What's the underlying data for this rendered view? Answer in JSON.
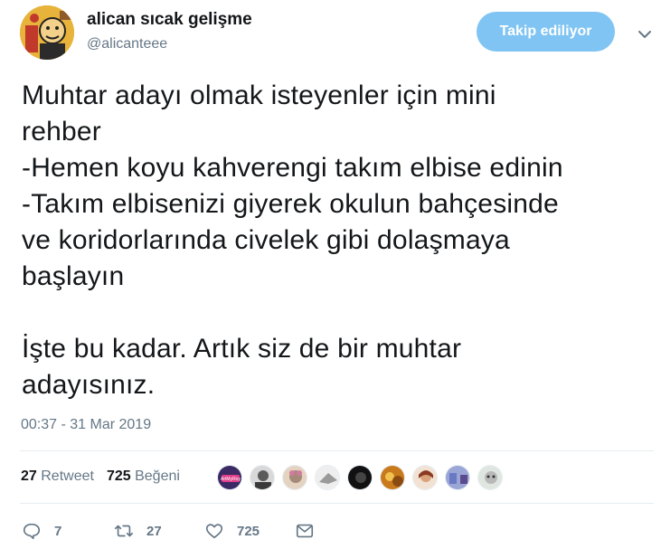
{
  "author": {
    "display_name": "alican sıcak gelişme",
    "handle": "@alicanteee",
    "follow_label": "Takip ediliyor"
  },
  "tweet": {
    "text": "Muhtar adayı olmak isteyenler için mini\nrehber\n-Hemen koyu kahverengi takım elbise edinin\n-Takım elbisenizi giyerek okulun bahçesinde\nve koridorlarında civelek gibi dolaşmaya\nbaşlayın\n\nİşte bu kadar. Artık siz de bir muhtar\nadayısınız.",
    "timestamp": "00:37 - 31 Mar 2019"
  },
  "stats": {
    "retweet_count": "27",
    "retweet_label": "Retweet",
    "like_count": "725",
    "like_label": "Beğeni"
  },
  "actions": {
    "reply_count": "7",
    "retweet_count": "27",
    "like_count": "725"
  },
  "likers_badge": "ArtMyRoy",
  "colors": {
    "accent": "#7fc4f3",
    "muted": "#657786",
    "text": "#14171a"
  },
  "icons": [
    "caret-down-icon",
    "reply-icon",
    "retweet-icon",
    "heart-icon",
    "message-icon"
  ]
}
